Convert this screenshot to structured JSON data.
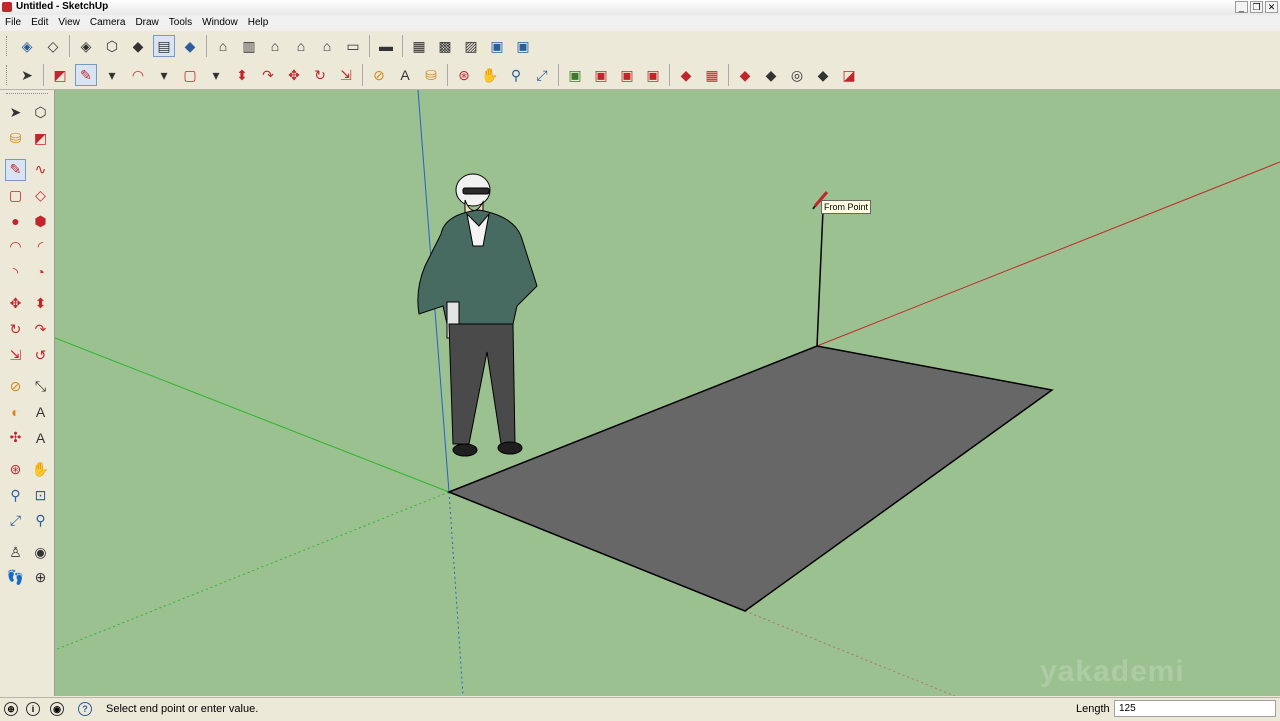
{
  "window": {
    "title": "Untitled - SketchUp",
    "buttons": [
      "_",
      "❐",
      "✕"
    ]
  },
  "menubar": [
    "File",
    "Edit",
    "View",
    "Camera",
    "Draw",
    "Tools",
    "Window",
    "Help"
  ],
  "toolbar1": [
    "iso-view-icon",
    "top-view-icon",
    "front-view-icon",
    "right-view-icon",
    "back-view-icon",
    "left-view-icon",
    "xray-icon",
    "wireframe-icon",
    "hidden-line-icon",
    "shaded-icon",
    "shaded-textures-icon",
    "monochrome-icon",
    "section-plane-icon",
    "component-icon",
    "house-icon",
    "front-house-icon",
    "right-house-icon",
    "back-house-icon",
    "left-house-icon",
    "layer-icon",
    "layers-icon"
  ],
  "toolbar2": [
    "select-icon",
    "eraser-icon",
    "line-icon",
    "arc-icon",
    "rectangle-icon",
    "push-pull-icon",
    "follow-me-icon",
    "move-icon",
    "rotate-icon",
    "scale-icon",
    "tape-measure-icon",
    "text-icon",
    "paint-bucket-icon",
    "orbit-icon",
    "pan-icon",
    "zoom-icon",
    "zoom-extents-icon",
    "get-models-icon",
    "share-model-icon",
    "share-component-icon",
    "photo-icon",
    "sandbox-icon",
    "terrain-icon",
    "smoove-icon",
    "stamp-icon",
    "drape-icon",
    "add-detail-icon",
    "flip-edge-icon"
  ],
  "tooltip": "From Point",
  "watermark": "yakademi",
  "status": {
    "message": "Select end point or enter value.",
    "vcb_label": "Length",
    "vcb_value": "125"
  },
  "colors": {
    "sky_ground": "#9cc190",
    "face": "#676767",
    "axis_red": "#c0272d",
    "axis_green": "#2fb52f",
    "axis_blue": "#2b5fc8"
  }
}
